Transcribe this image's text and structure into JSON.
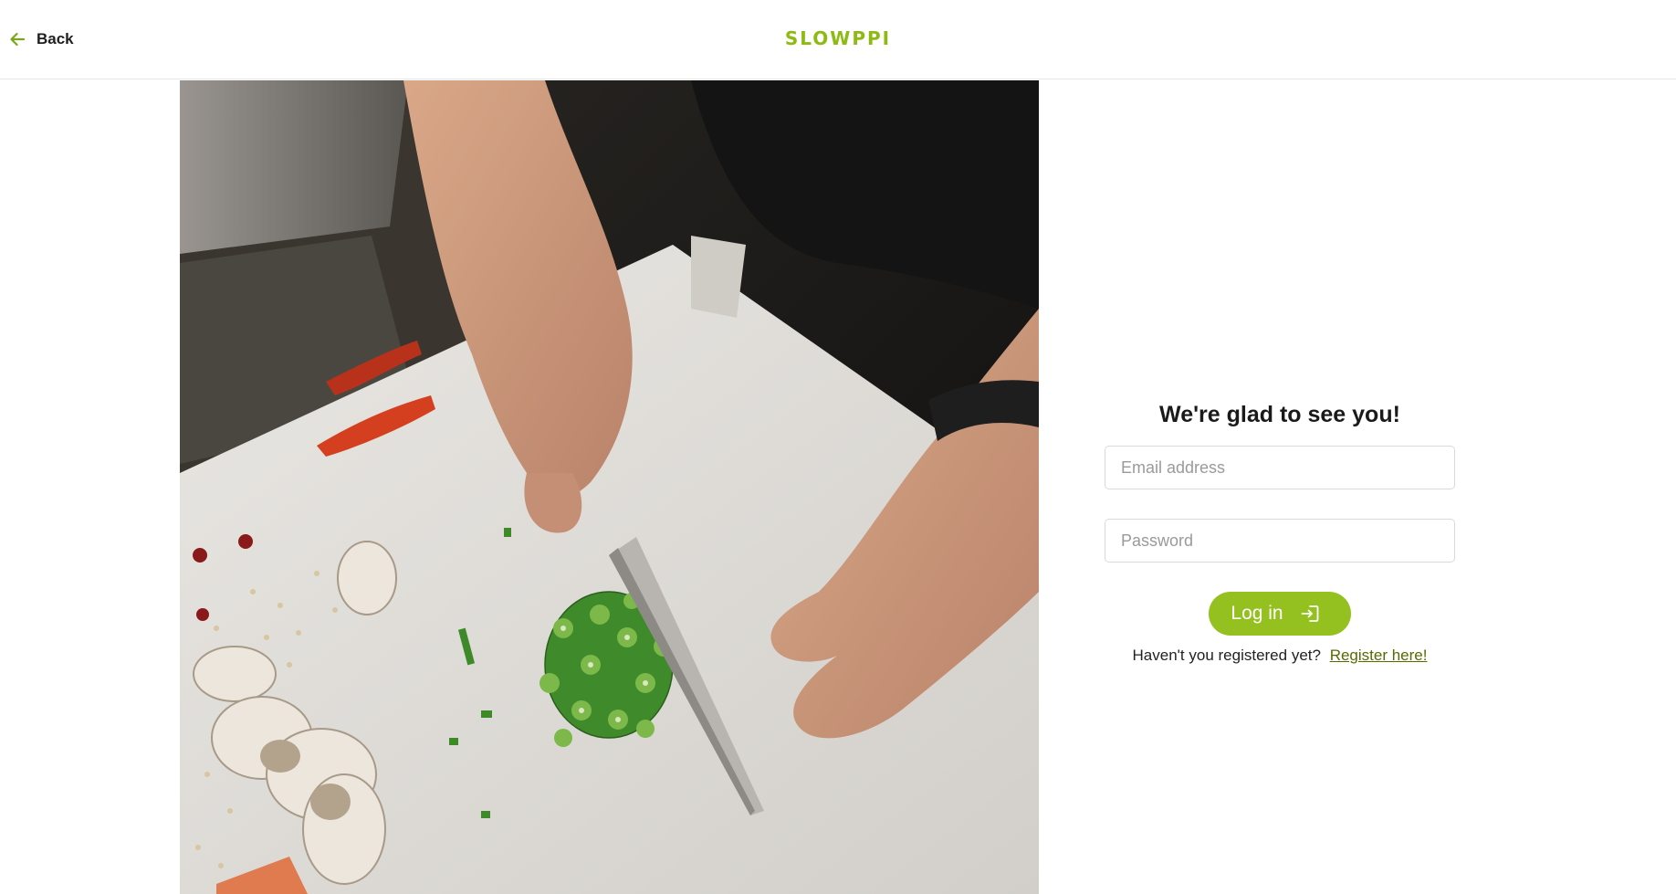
{
  "header": {
    "back_label": "Back",
    "back_icon": "arrow-left-icon",
    "logo_text": "SLOWPPI"
  },
  "hero": {
    "image_semantic": "chef-cutting-vegetables-photo"
  },
  "login": {
    "title": "We're glad to see you!",
    "email_placeholder": "Email address",
    "email_value": "",
    "password_placeholder": "Password",
    "password_value": "",
    "submit_label": "Log in",
    "submit_icon": "login-icon",
    "register_prompt": "Haven't you registered yet?",
    "register_link": "Register here!"
  },
  "colors": {
    "accent": "#94c11f",
    "logo": "#8dbb12",
    "link": "#556b00",
    "text": "#1d1d1d"
  }
}
